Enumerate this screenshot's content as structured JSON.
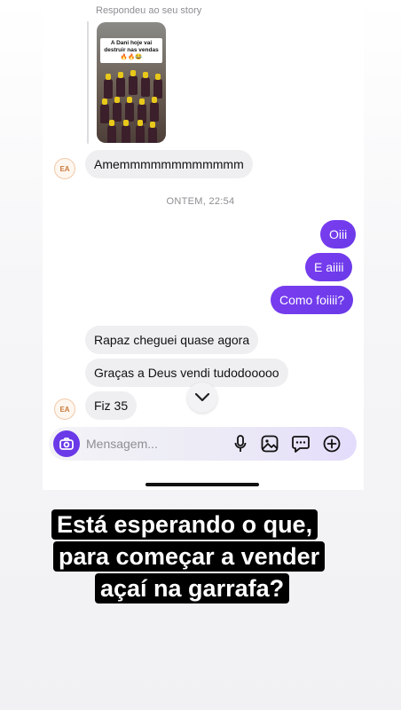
{
  "story_reply": {
    "caption": "Respondeu ao seu story",
    "thumbnail_text": "A Dani hoje vai destruir nas vendas🔥🔥😂"
  },
  "messages": {
    "incoming_1": "Amemmmmmmmmmmmm",
    "timestamp": "ONTEM, 22:54",
    "outgoing_1": "Oiii",
    "outgoing_2": "E aiiii",
    "outgoing_3": "Como foiiii?",
    "incoming_2": "Rapaz cheguei quase agora",
    "incoming_3": "Graças a Deus vendi tudodooooo",
    "incoming_4": "Fiz 35"
  },
  "avatar": {
    "initials": "EA"
  },
  "composer": {
    "placeholder": "Mensagem...",
    "icons": [
      "camera-icon",
      "microphone-icon",
      "image-icon",
      "sticker-icon",
      "plus-icon"
    ]
  },
  "overlay": {
    "line1": "Está esperando o que,",
    "line2": "para começar a vender",
    "line3": "açaí na garrafa?"
  },
  "colors": {
    "accent": "#6a3ae8",
    "incoming_bubble": "#efeff1",
    "overlay_bg": "#000000"
  }
}
